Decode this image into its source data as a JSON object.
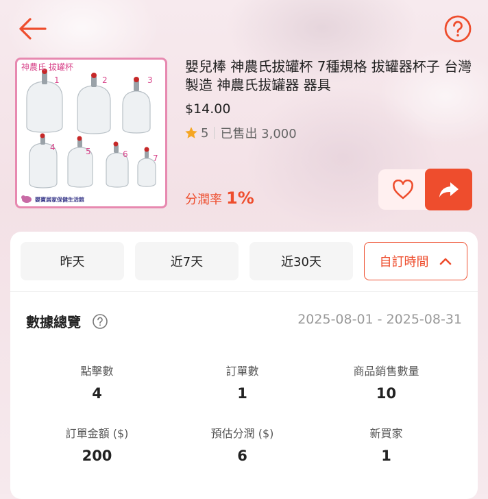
{
  "product": {
    "image_caption": "神農氏 拔罐杯",
    "image_footer": "嬰寶居家保健生活館",
    "image_numbers": [
      "1",
      "2",
      "3",
      "4",
      "5",
      "6",
      "7"
    ],
    "title": "嬰兒棒 神農氏拔罐杯 7種規格 拔罐器杯子 台灣製造 神農氏拔罐器 器具",
    "price": "$14.00",
    "rating": "5",
    "sold": "已售出 3,000",
    "commission_label": "分潤率",
    "commission_rate": "1%"
  },
  "icons": {
    "back": "back-arrow-icon",
    "help": "question-circle-icon",
    "star": "star-icon",
    "favorite": "heart-icon",
    "share": "share-arrow-icon"
  },
  "colors": {
    "accent": "#ee4d2d",
    "star": "#f5a623",
    "image_border": "#e789b0"
  },
  "tabs": [
    {
      "label": "昨天"
    },
    {
      "label": "近7天"
    },
    {
      "label": "近30天"
    },
    {
      "label": "自訂時間",
      "active": true
    }
  ],
  "overview": {
    "title": "數據總覽",
    "date_range": "2025-08-01 - 2025-08-31",
    "stats": [
      {
        "label": "點擊數",
        "value": "4"
      },
      {
        "label": "訂單數",
        "value": "1"
      },
      {
        "label": "商品銷售數量",
        "value": "10"
      },
      {
        "label": "訂單金額 ($)",
        "value": "200"
      },
      {
        "label": "預估分潤 ($)",
        "value": "6"
      },
      {
        "label": "新買家",
        "value": "1"
      }
    ]
  }
}
